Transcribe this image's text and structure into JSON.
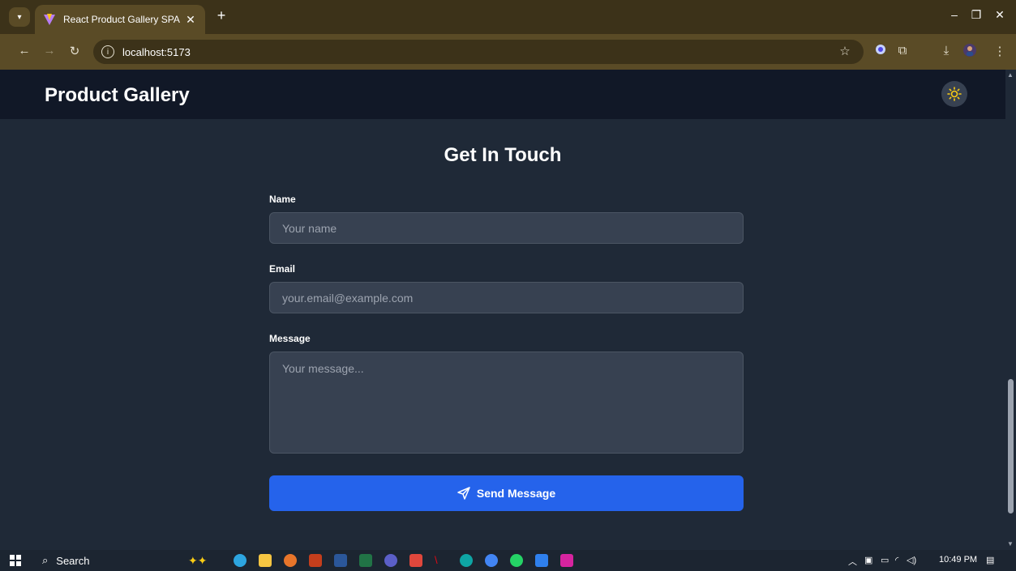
{
  "browser": {
    "tab_title": "React Product Gallery SPA",
    "url": "localhost:5173"
  },
  "app": {
    "brand": "Product Gallery"
  },
  "contact": {
    "title": "Get In Touch",
    "name_label": "Name",
    "name_placeholder": "Your name",
    "email_label": "Email",
    "email_placeholder": "your.email@example.com",
    "message_label": "Message",
    "message_placeholder": "Your message...",
    "submit_label": "Send Message"
  },
  "taskbar": {
    "search_label": "Search",
    "time": "10:49 PM"
  },
  "colors": {
    "accent": "#2563eb",
    "page_bg": "#1f2937",
    "header_bg": "#111827",
    "input_bg": "#374151"
  },
  "icons": {
    "theme_toggle": "sun-icon",
    "submit": "send-icon"
  }
}
